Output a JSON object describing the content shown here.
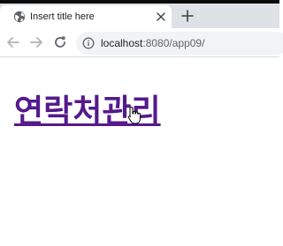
{
  "browser": {
    "tab": {
      "title": "Insert title here",
      "favicon": "globe-icon",
      "close_icon": "close-icon"
    },
    "new_tab_icon": "plus-icon",
    "toolbar": {
      "back_icon": "arrow-left-icon",
      "forward_icon": "arrow-right-icon",
      "reload_icon": "reload-icon",
      "info_icon": "info-icon"
    },
    "address": {
      "host": "localhost",
      "path": ":8080/app09/"
    }
  },
  "page": {
    "link_text": "연락처관리",
    "link_color": "#551a8b",
    "cursor": "hand-pointer-icon"
  },
  "colors": {
    "tab_strip": "#dee1e6",
    "omnibox": "#f1f3f4"
  }
}
